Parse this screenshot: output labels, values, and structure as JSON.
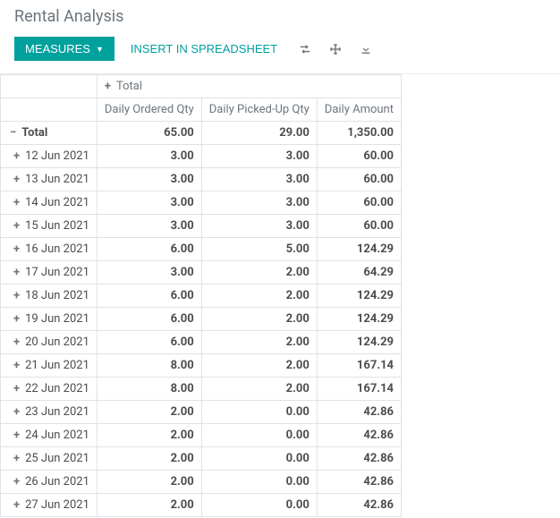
{
  "page_title": "Rental Analysis",
  "toolbar": {
    "measures_label": "MEASURES",
    "insert_label": "INSERT IN SPREADSHEET"
  },
  "pivot": {
    "total_label": "Total",
    "columns": [
      "Daily Ordered Qty",
      "Daily Picked-Up Qty",
      "Daily Amount"
    ],
    "total_row": {
      "label": "Total",
      "values": [
        "65.00",
        "29.00",
        "1,350.00"
      ]
    },
    "rows": [
      {
        "label": "12 Jun 2021",
        "values": [
          "3.00",
          "3.00",
          "60.00"
        ]
      },
      {
        "label": "13 Jun 2021",
        "values": [
          "3.00",
          "3.00",
          "60.00"
        ]
      },
      {
        "label": "14 Jun 2021",
        "values": [
          "3.00",
          "3.00",
          "60.00"
        ]
      },
      {
        "label": "15 Jun 2021",
        "values": [
          "3.00",
          "3.00",
          "60.00"
        ]
      },
      {
        "label": "16 Jun 2021",
        "values": [
          "6.00",
          "5.00",
          "124.29"
        ]
      },
      {
        "label": "17 Jun 2021",
        "values": [
          "3.00",
          "2.00",
          "64.29"
        ]
      },
      {
        "label": "18 Jun 2021",
        "values": [
          "6.00",
          "2.00",
          "124.29"
        ]
      },
      {
        "label": "19 Jun 2021",
        "values": [
          "6.00",
          "2.00",
          "124.29"
        ]
      },
      {
        "label": "20 Jun 2021",
        "values": [
          "6.00",
          "2.00",
          "124.29"
        ]
      },
      {
        "label": "21 Jun 2021",
        "values": [
          "8.00",
          "2.00",
          "167.14"
        ]
      },
      {
        "label": "22 Jun 2021",
        "values": [
          "8.00",
          "2.00",
          "167.14"
        ]
      },
      {
        "label": "23 Jun 2021",
        "values": [
          "2.00",
          "0.00",
          "42.86"
        ]
      },
      {
        "label": "24 Jun 2021",
        "values": [
          "2.00",
          "0.00",
          "42.86"
        ]
      },
      {
        "label": "25 Jun 2021",
        "values": [
          "2.00",
          "0.00",
          "42.86"
        ]
      },
      {
        "label": "26 Jun 2021",
        "values": [
          "2.00",
          "0.00",
          "42.86"
        ]
      },
      {
        "label": "27 Jun 2021",
        "values": [
          "2.00",
          "0.00",
          "42.86"
        ]
      }
    ]
  }
}
